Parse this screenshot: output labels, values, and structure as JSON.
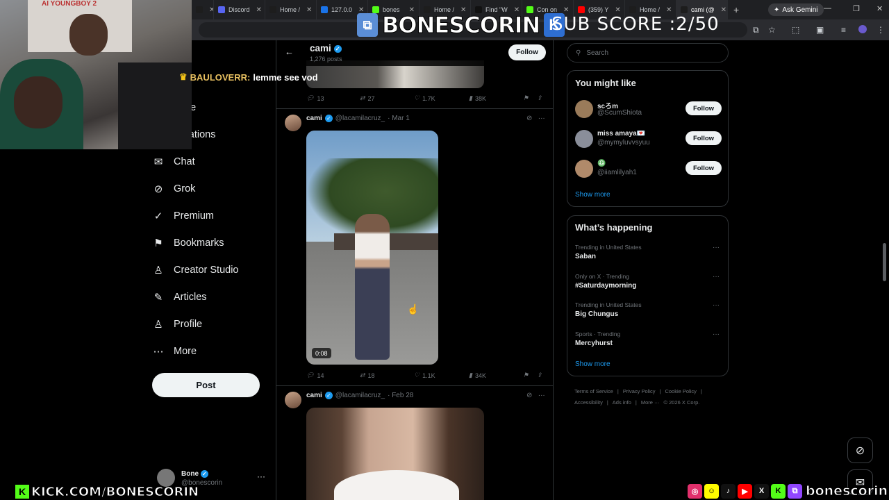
{
  "browser": {
    "tabs": [
      {
        "label": "Home /",
        "color": "#1d1d1d"
      },
      {
        "label": "Discord",
        "color": "#5865f2"
      },
      {
        "label": "Home /",
        "color": "#1d1d1d"
      },
      {
        "label": "127.0.0",
        "color": "#1a73e8"
      },
      {
        "label": "bones",
        "color": "#53fc18"
      },
      {
        "label": "Home /",
        "color": "#1d1d1d"
      },
      {
        "label": "Find \"W",
        "color": "#111111"
      },
      {
        "label": "Con on",
        "color": "#53fc18"
      },
      {
        "label": "(359) Y",
        "color": "#ff0000"
      },
      {
        "label": "Home /",
        "color": "#1d1d1d"
      },
      {
        "label": "cami (@",
        "color": "#1d1d1d"
      }
    ],
    "ask_gemini": "Ask Gemini"
  },
  "overlay": {
    "poster_text": "AI YOUNGBOY 2",
    "brand_name": "BONESCORIN",
    "sub_score": "SUB SCORE :2/50",
    "chat_user": "BAULOVERR:",
    "chat_text": "lemme see vod",
    "kick_url": "KICK.COM/BONESCORIN",
    "social_handle": "bonescorin"
  },
  "nav": {
    "items": [
      {
        "label": "me",
        "icon": "home-icon"
      },
      {
        "label": "plore",
        "icon": "search-icon"
      },
      {
        "label": "tifications",
        "icon": "bell-icon"
      },
      {
        "label": "Chat",
        "icon": "mail-icon"
      },
      {
        "label": "Grok",
        "icon": "grok-icon"
      },
      {
        "label": "Premium",
        "icon": "premium-icon"
      },
      {
        "label": "Bookmarks",
        "icon": "bookmark-icon"
      },
      {
        "label": "Creator Studio",
        "icon": "creator-icon"
      },
      {
        "label": "Articles",
        "icon": "article-icon"
      },
      {
        "label": "Profile",
        "icon": "profile-icon"
      },
      {
        "label": "More",
        "icon": "more-icon"
      }
    ],
    "post_label": "Post",
    "account": {
      "name": "Bone",
      "handle": "@bonescorin"
    }
  },
  "profile": {
    "name": "cami",
    "post_count": "1,276 posts",
    "follow_label": "Follow"
  },
  "tweets": [
    {
      "replies": "13",
      "reposts": "27",
      "likes": "1.7K",
      "views": "38K"
    },
    {
      "name": "cami",
      "handle": "@lacamilacruz_",
      "date": "· Mar 1",
      "duration": "0:08",
      "replies": "14",
      "reposts": "18",
      "likes": "1.1K",
      "views": "34K"
    },
    {
      "name": "cami",
      "handle": "@lacamilacruz_",
      "date": "· Feb 28"
    }
  ],
  "sidebar": {
    "search_placeholder": "Search",
    "might_like_title": "You might like",
    "suggestions": [
      {
        "name": "scろm",
        "handle": "@ScumShiota",
        "follow": "Follow",
        "avatar": "#9a7b5a"
      },
      {
        "name": "miss amaya💌",
        "handle": "@mymyluvvsyuu",
        "follow": "Follow",
        "avatar": "#8a8e9a"
      },
      {
        "name": "♎",
        "handle": "@iiamlilyah1",
        "follow": "Follow",
        "avatar": "#b08a6a"
      }
    ],
    "show_more": "Show more",
    "happening_title": "What’s happening",
    "trends": [
      {
        "context": "Trending in United States",
        "title": "Saban"
      },
      {
        "context": "Only on X · Trending",
        "title": "#Saturdaymorning"
      },
      {
        "context": "Trending in United States",
        "title": "Big Chungus"
      },
      {
        "context": "Sports · Trending",
        "title": "Mercyhurst"
      }
    ],
    "show_more_trends": "Show more",
    "footer": [
      "Terms of Service",
      "|",
      "Privacy Policy",
      "|",
      "Cookie Policy",
      "|",
      "Accessibility",
      "|",
      "Ads info",
      "|",
      "More ···",
      "© 2026 X Corp."
    ]
  }
}
